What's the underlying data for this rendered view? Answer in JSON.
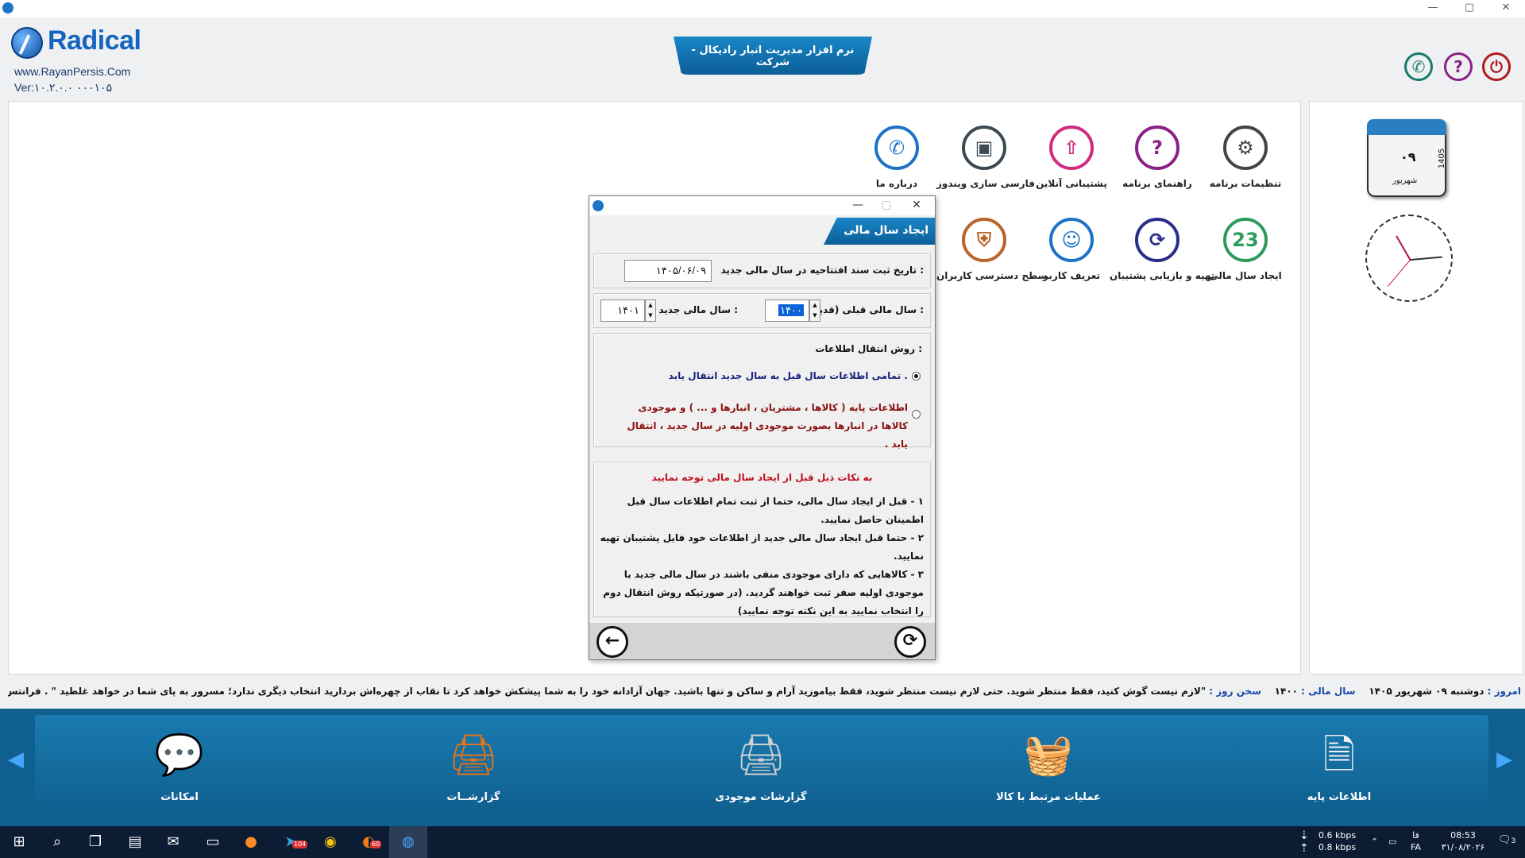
{
  "window": {
    "title_tab": "نرم افزار مدیریت انبار رادیکال - شرکت",
    "controls": {
      "minimize": "—",
      "restore": "▢",
      "close": "✕"
    }
  },
  "brand": {
    "name": "Radical",
    "website": "www.RayanPersis.Com",
    "version": "Ver:۱۰.۲.۰.۰    ۰۰۰۱۰۵"
  },
  "header_buttons": [
    {
      "name": "call-icon",
      "glyph": "✆",
      "color": "#167a6a"
    },
    {
      "name": "help-icon",
      "glyph": "?",
      "color": "#8a2187"
    },
    {
      "name": "exit-icon",
      "glyph": "⏻",
      "color": "#b0191c"
    }
  ],
  "tiles_row1": [
    {
      "label": "تنظیمات برنامه",
      "icon": "gear-icon",
      "glyph": "⚙",
      "color": "#444444"
    },
    {
      "label": "راهنمای برنامه",
      "icon": "question-icon",
      "glyph": "?",
      "color": "#8a2187"
    },
    {
      "label": "پشتیبانی آنلاین",
      "icon": "cloud-upload-icon",
      "glyph": "⇧",
      "color": "#d02c7c"
    },
    {
      "label": "فارسی سازی ویندوز",
      "icon": "monitor-icon",
      "glyph": "▣",
      "color": "#3e4a52"
    },
    {
      "label": "درباره ما",
      "icon": "phone-icon",
      "glyph": "✆",
      "color": "#1e73c6"
    }
  ],
  "tiles_row2": [
    {
      "label": "ایجاد سال مالی",
      "icon": "calendar-icon",
      "glyph": "23",
      "color": "#2e9a5e"
    },
    {
      "label": "تهیه و بازیابی پشتیبان",
      "icon": "backup-icon",
      "glyph": "⟳",
      "color": "#2a2e8a"
    },
    {
      "label": "تعریف کاربر",
      "icon": "user-icon",
      "glyph": "☺",
      "color": "#1e73c6"
    },
    {
      "label": "سطح دسترسی کاربران",
      "icon": "shield-icon",
      "glyph": "⛨",
      "color": "#b9642a"
    }
  ],
  "calendar": {
    "day": "۰۹",
    "month": "شهریور",
    "year": "1405"
  },
  "dialog": {
    "title": "ایجاد سال مالی",
    "opening_date_label": "تاریخ ثبت سند افتتاحیه در سال مالی جدید :",
    "opening_date_value": "۱۴۰۵/۰۶/۰۹",
    "old_year_label": "سال مالی قبلی (قدیم) :",
    "old_year_value": "۱۴۰۰",
    "new_year_label": "سال مالی جدید :",
    "new_year_value": "۱۴۰۱",
    "transfer_title": "روش انتقال اطلاعات :",
    "option_all": "تمامی اطلاعات سال قبل به سال جدید  انتقال یابد .",
    "option_base": "اطلاعات پایه ( کالاها ، مشتریان ، انبارها و ... ) و موجودی کالاها در انبارها بصورت موجودی اولیه در سال جدید ، انتقال یابد .",
    "notes_title": "به نکات ذیل قبل از ایجاد سال مالی توجه نمایید",
    "notes": [
      "۱ - قبل از ایجاد سال مالی، حتما از ثبت تمام اطلاعات سال قبل اطمینان حاصل نمایید.",
      "۲ - حتما قبل ایجاد سال مالی جدید از اطلاعات خود فایل پشتیبان تهیه نمایید.",
      "۳ - کالاهایی که دارای موجودی منفی باشند در سال مالی جدید با موجودی اولیه صفر ثبت خواهند گردید. (در صورتیکه روش انتقال دوم را انتخاب نمایید به این نکته توجه نمایید)"
    ]
  },
  "status": {
    "today_label": "امروز :",
    "today_value": "دوشنبه ۰۹ شهریور ۱۴۰۵",
    "fiscal_label": "سال مالی :",
    "fiscal_value": "۱۴۰۰",
    "quote_label": "سخن روز :",
    "quote_value": "\"لازم نیست گوش کنید، فقط منتظر شوید. حتی لازم نیست منتظر شوید، فقط بیاموزید آرام و ساکن و تنها باشید. جهان آزادانه خود را به شما پیشکش خواهد کرد تا نقاب از چهره‌اش بردارید انتخاب دیگری ندارد؛ مسرور به پای شما در خواهد غلطید \" . فرانتس کافکا"
  },
  "dock": [
    {
      "label": "اطلاعات پایه",
      "icon": "documents-icon"
    },
    {
      "label": "عملیات مرتبط با کالا",
      "icon": "basket-icon"
    },
    {
      "label": "گزارشات موجودی",
      "icon": "printer-star-icon"
    },
    {
      "label": "گزارشــات",
      "icon": "report-printer-icon"
    },
    {
      "label": "امکانات",
      "icon": "chat-pencil-icon"
    }
  ],
  "taskbar": {
    "telegram_badge": "104",
    "app_badge": "60",
    "net_down": "0.6 kbps",
    "net_up": "0.8 kbps",
    "lang1": "فا",
    "lang2": "FA",
    "time": "08:53",
    "date": "۳۱/۰۸/۲۰۲۶",
    "notif_count": "3"
  }
}
